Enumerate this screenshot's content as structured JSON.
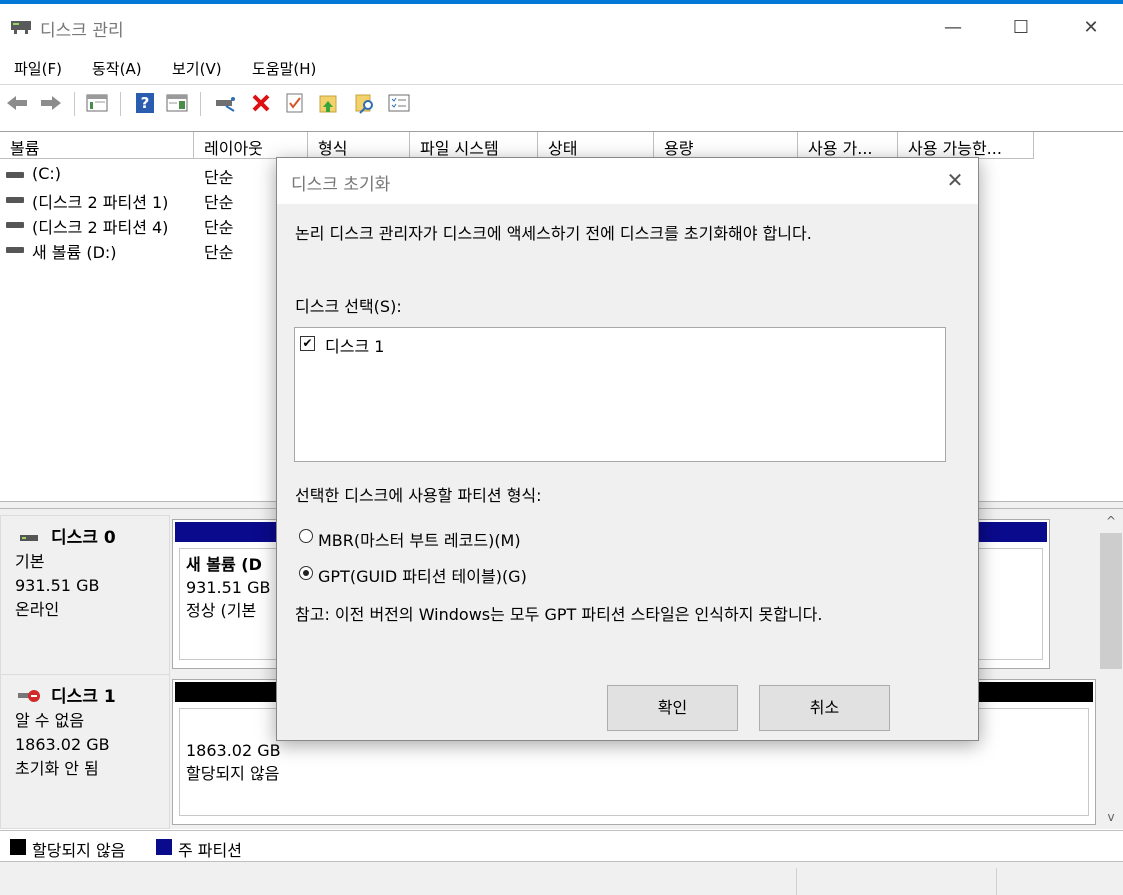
{
  "window": {
    "title": "디스크 관리",
    "minimize": "—",
    "maximize": "☐",
    "close": "✕"
  },
  "menu": {
    "items": [
      "파일(F)",
      "동작(A)",
      "보기(V)",
      "도움말(H)"
    ]
  },
  "toolbar": {
    "icons": [
      "back-arrow-icon",
      "forward-arrow-icon",
      "console-tree-icon",
      "help-icon",
      "show-pane-icon",
      "connect-drive-icon",
      "delete-icon",
      "properties-icon",
      "folder-up-icon",
      "folder-search-icon",
      "list-view-icon"
    ]
  },
  "volume_table": {
    "headers": [
      "볼륨",
      "레이아웃",
      "형식",
      "파일 시스템",
      "상태",
      "용량",
      "사용 가...",
      "사용 가능한..."
    ],
    "rows": [
      {
        "name": "(C:)",
        "layout": "단순"
      },
      {
        "name": "(디스크 2 파티션 1)",
        "layout": "단순"
      },
      {
        "name": "(디스크 2 파티션 4)",
        "layout": "단순"
      },
      {
        "name": "새 볼륨 (D:)",
        "layout": "단순"
      }
    ]
  },
  "disks": [
    {
      "name": "디스크 0",
      "type": "기본",
      "size": "931.51 GB",
      "status": "온라인",
      "partition": {
        "name": "새 볼륨  (D",
        "size": "931.51 GB N",
        "status": "정상 (기본"
      },
      "bar_color": "#0a0a8c"
    },
    {
      "name": "디스크 1",
      "type": "알 수 없음",
      "size": "1863.02 GB",
      "status": "초기화 안 됨",
      "partition": {
        "size": "1863.02 GB",
        "status": "할당되지 않음"
      },
      "bar_color": "#000000"
    }
  ],
  "legend": [
    {
      "label": "할당되지 않음",
      "color": "#000000"
    },
    {
      "label": "주 파티션",
      "color": "#0a0a8c"
    }
  ],
  "scrollbar": {
    "up": "^",
    "down": "v"
  },
  "dialog": {
    "title": "디스크 초기화",
    "close": "✕",
    "intro": "논리 디스크 관리자가 디스크에 액세스하기 전에 디스크를 초기화해야 합니다.",
    "select_label": "디스크 선택(S):",
    "disk_items": [
      {
        "label": "디스크 1",
        "checked": true
      }
    ],
    "check_mark": "✔",
    "partition_style_label": "선택한 디스크에 사용할 파티션 형식:",
    "options": [
      {
        "label": "MBR(마스터 부트 레코드)(M)",
        "selected": false
      },
      {
        "label": "GPT(GUID 파티션 테이블)(G)",
        "selected": true
      }
    ],
    "note": "참고: 이전 버전의 Windows는 모두 GPT 파티션 스타일은 인식하지 못합니다.",
    "ok_label": "확인",
    "cancel_label": "취소"
  }
}
